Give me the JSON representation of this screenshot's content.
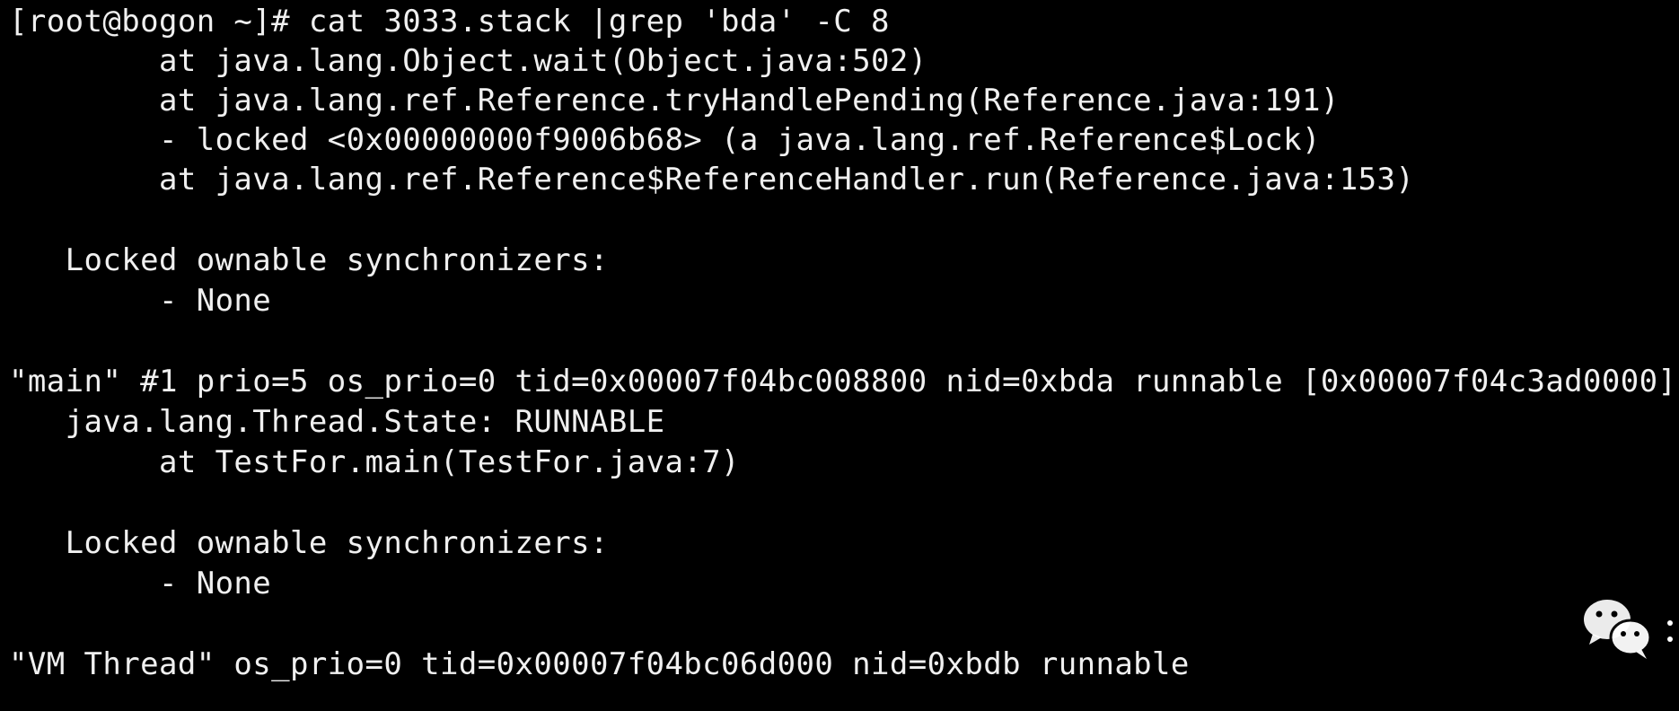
{
  "terminal": {
    "background": "#000000",
    "foreground": "#f0f0f0",
    "lines": [
      "[root@bogon ~]# cat 3033.stack |grep 'bda' -C 8",
      "        at java.lang.Object.wait(Object.java:502)",
      "        at java.lang.ref.Reference.tryHandlePending(Reference.java:191)",
      "        - locked <0x00000000f9006b68> (a java.lang.ref.Reference$Lock)",
      "        at java.lang.ref.Reference$ReferenceHandler.run(Reference.java:153)",
      "",
      "   Locked ownable synchronizers:",
      "        - None",
      "",
      "\"main\" #1 prio=5 os_prio=0 tid=0x00007f04bc008800 nid=0xbda runnable [0x00007f04c3ad0000]",
      "   java.lang.Thread.State: RUNNABLE",
      "        at TestFor.main(TestFor.java:7)",
      "",
      "   Locked ownable synchronizers:",
      "        - None",
      "",
      "\"VM Thread\" os_prio=0 tid=0x00007f04bc06d000 nid=0xbdb runnable"
    ]
  },
  "watermark": {
    "icon": "wechat-logo-icon",
    "color": "#ffffff"
  }
}
